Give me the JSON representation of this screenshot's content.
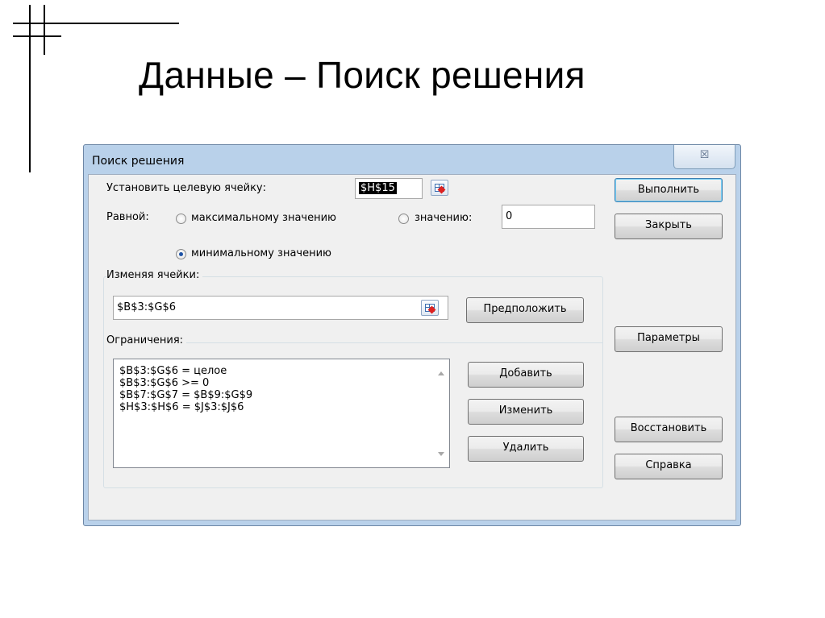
{
  "slide": {
    "title": "Данные – Поиск решения"
  },
  "dialog": {
    "title": "Поиск решения",
    "close_glyph": "☒",
    "target_label": "Установить целевую ячейку:",
    "target_value": "$H$15",
    "equal_label": "Равной:",
    "radio_max_label": "максимальному значению",
    "radio_value_label": "значению:",
    "value_input": "0",
    "radio_min_label": "минимальному значению",
    "selected_radio": "min",
    "changing_label": "Изменяя ячейки:",
    "changing_value": "$B$3:$G$6",
    "guess_button": "Предположить",
    "constraints_label": "Ограничения:",
    "constraints": [
      "$B$3:$G$6 = целое",
      "$B$3:$G$6 >= 0",
      "$B$7:$G$7 = $B$9:$G$9",
      "$H$3:$H$6 = $J$3:$J$6"
    ],
    "add_button": "Добавить",
    "change_button": "Изменить",
    "delete_button": "Удалить",
    "solve_button": "Выполнить",
    "close_button": "Закрыть",
    "options_button": "Параметры",
    "reset_button": "Восстановить",
    "help_button": "Справка"
  }
}
